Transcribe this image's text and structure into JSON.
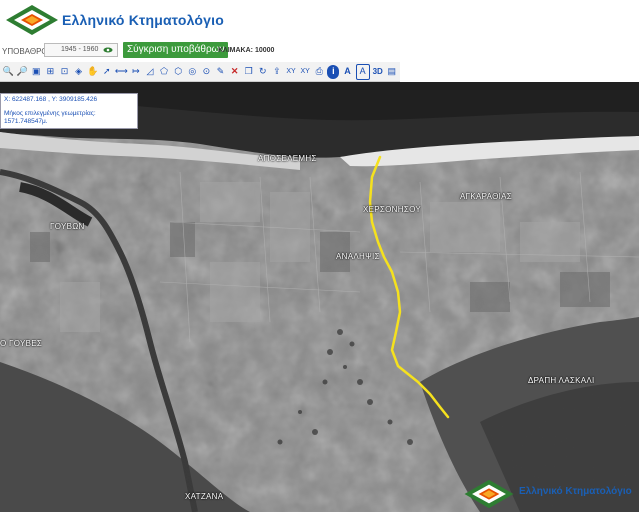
{
  "header": {
    "brand": "Ελληνικό Κτηματολόγιο",
    "logo": "ktimatologio-logo"
  },
  "controls": {
    "basemap_label": "ΥΠΟΒΑΘΡΟ:",
    "basemap_value": "1945 - 1960",
    "compare_label": "Σύγκριση υποβάθρων",
    "scale_label": "ΚΛΙΜΑΚΑ: 10000"
  },
  "toolbar": {
    "tools": [
      "zoom-in-icon",
      "zoom-out-icon",
      "zoom-extent-icon",
      "zoom-box-icon",
      "zoom-window-icon",
      "zoom-previous-icon",
      "pan-hand-icon",
      "select-arrow-icon",
      "measure-line-icon",
      "measure-distance-icon",
      "measure-area-icon",
      "draw-polygon-icon",
      "draw-shape-icon",
      "target-icon",
      "locate-point-icon",
      "edit-pencil-icon",
      "delete-x-icon",
      "copy-icon",
      "refresh-icon",
      "export-icon",
      "xy-coordinates-icon",
      "xy-transform-icon",
      "print-icon",
      "info-icon",
      "text-a-icon",
      "select-text-icon",
      "3d-view-icon",
      "layers-icon"
    ]
  },
  "coordinates": {
    "xy": "X: 622487.168 , Y: 3909185.426",
    "length_label": "Μήκος επιλεγμένης γεωμετρίας:",
    "length_value": "1571.748547μ."
  },
  "places": {
    "aposelemis": "ΑΠΟΣΕΛΕΜΗΣ",
    "chersonisou": "ΧΕΡΣΟΝΗΣΟΥ",
    "agkarathias": "ΑΓΚΑΡΑΘΙΑΣ",
    "analipsis": "ΑΝΑΛΗΨΙΣ",
    "gouvon": "ΓΟΥΒΩΝ",
    "gouves": "Ο ΓΟΥΒΕΣ",
    "drapi_laskali": "ΔΡΑΠΗ ΛΑΣΚΑΛΙ",
    "chatzana": "ΧΑΤΖΑΝΑ"
  },
  "measured_line": {
    "color": "#f5e11e"
  },
  "colors": {
    "brand": "#1a5fb4",
    "compare_button": "#3c9a3c"
  }
}
